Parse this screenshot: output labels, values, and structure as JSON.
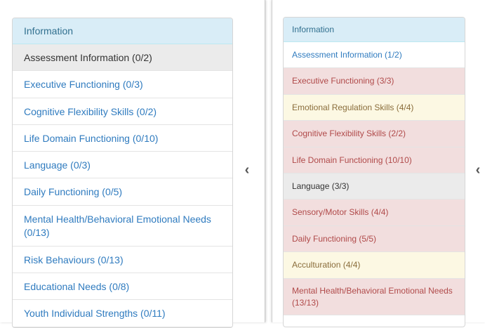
{
  "left_panel": {
    "heading": "Information",
    "items": [
      {
        "label": "Assessment Information (0/2)",
        "state": "active"
      },
      {
        "label": "Executive Functioning (0/3)",
        "state": "link"
      },
      {
        "label": "Cognitive Flexibility Skills (0/2)",
        "state": "link"
      },
      {
        "label": "Life Domain Functioning (0/10)",
        "state": "link"
      },
      {
        "label": "Language (0/3)",
        "state": "link"
      },
      {
        "label": "Daily Functioning (0/5)",
        "state": "link"
      },
      {
        "label": "Mental Health/Behavioral Emotional Needs (0/13)",
        "state": "link"
      },
      {
        "label": "Risk Behaviours (0/13)",
        "state": "link"
      },
      {
        "label": "Educational Needs (0/8)",
        "state": "link"
      },
      {
        "label": "Youth Individual Strengths (0/11)",
        "state": "link"
      }
    ],
    "collapse_icon": "chevron-left-icon",
    "collapse_glyph": "‹"
  },
  "right_panel": {
    "heading": "Information",
    "items": [
      {
        "label": "Assessment Information (1/2)",
        "state": "link"
      },
      {
        "label": "Executive Functioning (3/3)",
        "state": "complete"
      },
      {
        "label": "Emotional Regulation Skills (4/4)",
        "state": "partial"
      },
      {
        "label": "Cognitive Flexibility Skills (2/2)",
        "state": "complete"
      },
      {
        "label": "Life Domain Functioning (10/10)",
        "state": "complete"
      },
      {
        "label": "Language (3/3)",
        "state": "active"
      },
      {
        "label": "Sensory/Motor Skills (4/4)",
        "state": "complete"
      },
      {
        "label": "Daily Functioning (5/5)",
        "state": "complete"
      },
      {
        "label": "Acculturation (4/4)",
        "state": "partial"
      },
      {
        "label": "Mental Health/Behavioral Emotional Needs (13/13)",
        "state": "complete"
      }
    ],
    "collapse_icon": "chevron-left-icon",
    "collapse_glyph": "‹"
  },
  "colors": {
    "heading_bg": "#d9edf7",
    "heading_text": "#31708f",
    "link": "#2f7bbf",
    "active_bg": "#ebebeb",
    "complete_bg": "#f2dede",
    "partial_bg": "#fcf8e3"
  }
}
